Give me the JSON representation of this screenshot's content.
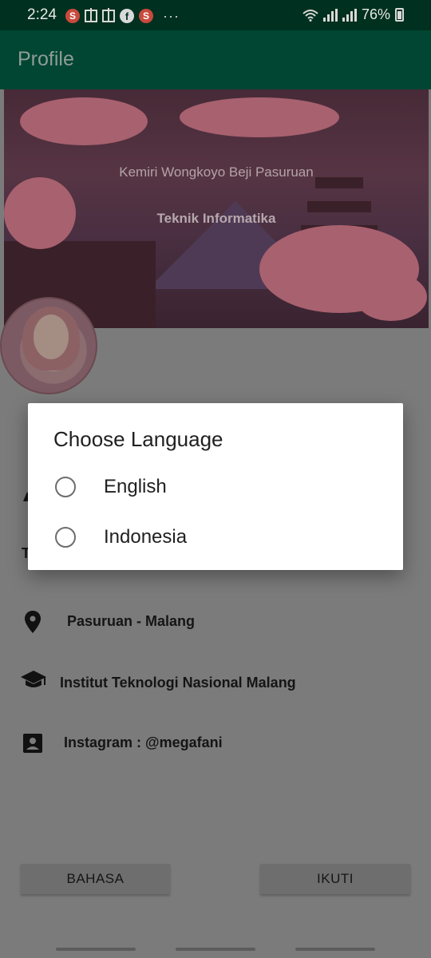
{
  "status_bar": {
    "time": "2:24",
    "battery": "76%",
    "left_icons": [
      "s-app-icon",
      "gift-icon",
      "gift-icon",
      "facebook-icon",
      "s-app-icon"
    ],
    "more": "···"
  },
  "app_bar": {
    "title": "Profile"
  },
  "header": {
    "address": "Kemiri Wongkoyo Beji Pasuruan",
    "department": "Teknik Informatika"
  },
  "partial_hidden_text": "T",
  "info": {
    "location": "Pasuruan - Malang",
    "school": "Institut Teknologi Nasional Malang",
    "instagram": "Instagram : @megafani"
  },
  "buttons": {
    "bahasa": "BAHASA",
    "ikuti": "IKUTI"
  },
  "dialog": {
    "title": "Choose Language",
    "options": [
      {
        "label": "English",
        "selected": false
      },
      {
        "label": "Indonesia",
        "selected": false
      }
    ]
  },
  "colors": {
    "app_bar": "#014633",
    "status_bar": "#00301f",
    "scrim_background": "#7b7b7b",
    "dialog_background": "#ffffff"
  }
}
